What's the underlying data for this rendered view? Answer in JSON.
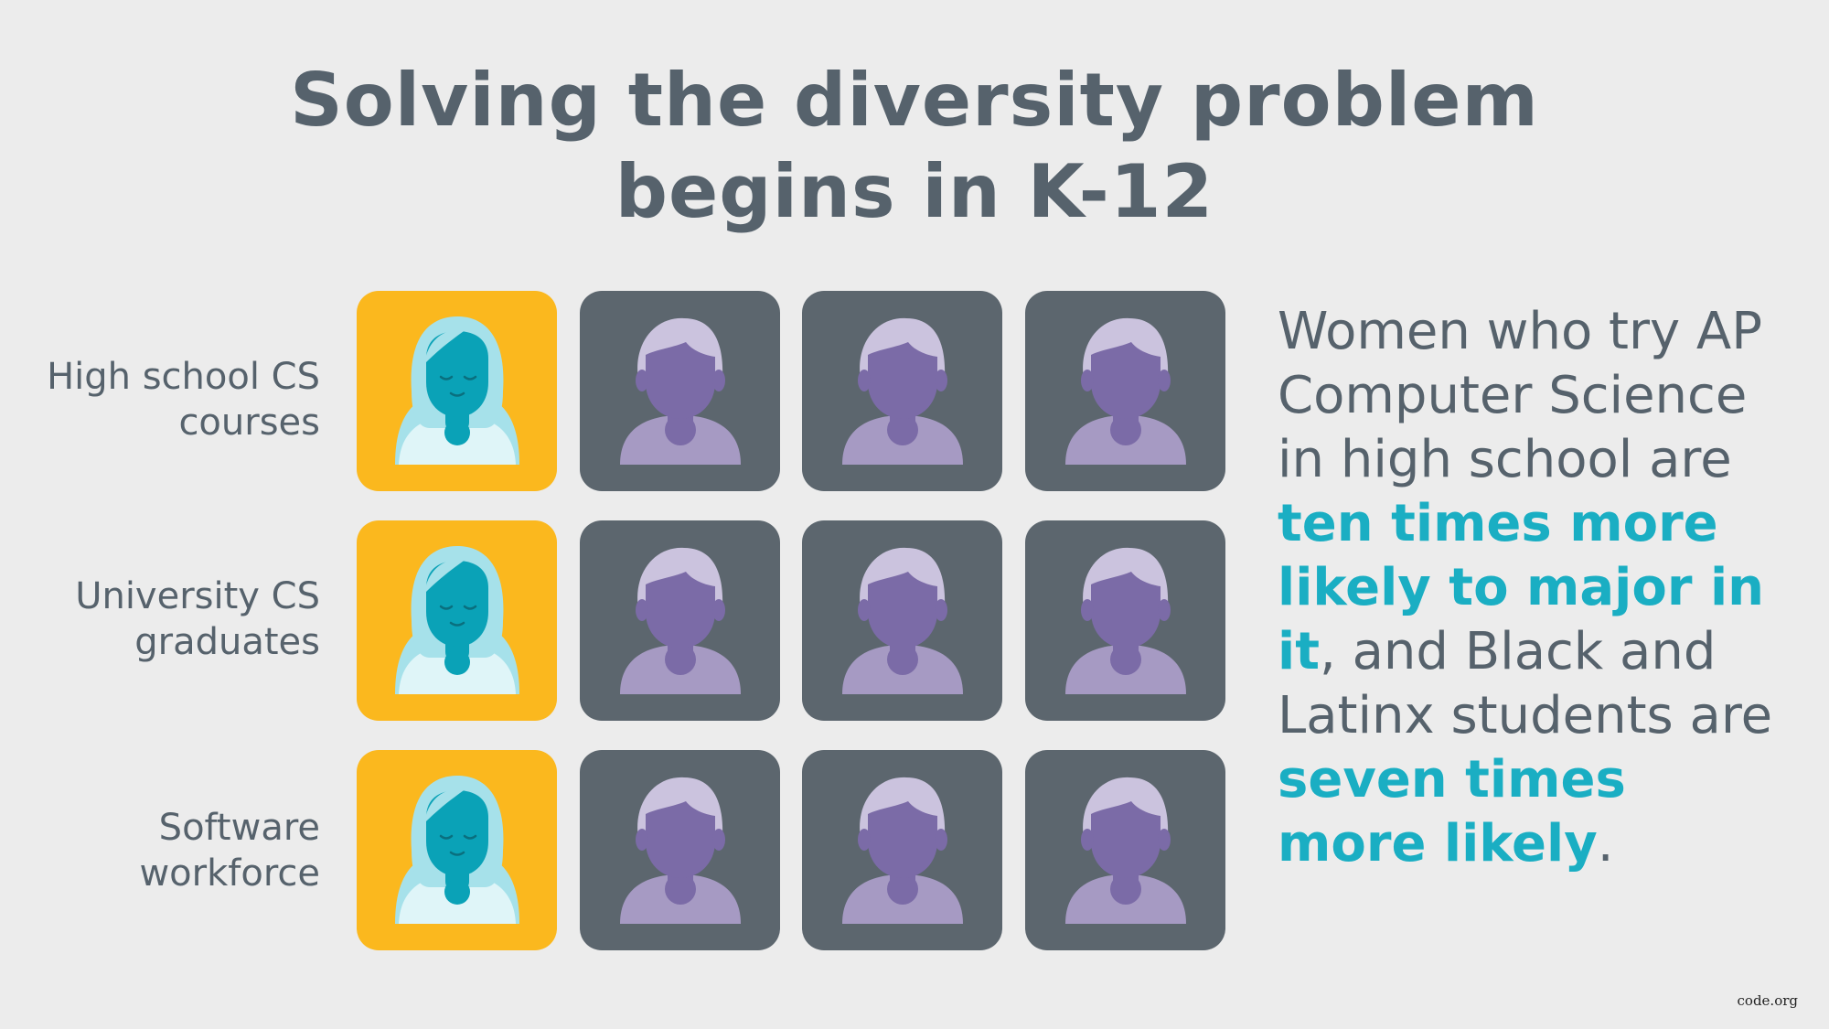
{
  "title": {
    "line1": "Solving the diversity problem",
    "line2": "begins in K-12"
  },
  "rows": [
    {
      "label_line1": "High school CS",
      "label_line2": "courses"
    },
    {
      "label_line1": "University CS",
      "label_line2": "graduates"
    },
    {
      "label_line1": "Software",
      "label_line2": "workforce"
    }
  ],
  "grid": {
    "per_row": {
      "female": 1,
      "male": 3
    },
    "icons": {
      "female": "woman-avatar-icon",
      "male": "man-avatar-icon"
    }
  },
  "colors": {
    "background": "#ececec",
    "text": "#56626c",
    "highlight": "#1aaec3",
    "female_tile": "#fbb81e",
    "male_tile": "#5c666e"
  },
  "side_text": {
    "p1": "Women who try AP Computer Science in high school are ",
    "h1": "ten times more likely to major in it",
    "p2": ", and Black and Latinx students are ",
    "h2": "seven times more likely",
    "p3": "."
  },
  "credit": "code.org"
}
